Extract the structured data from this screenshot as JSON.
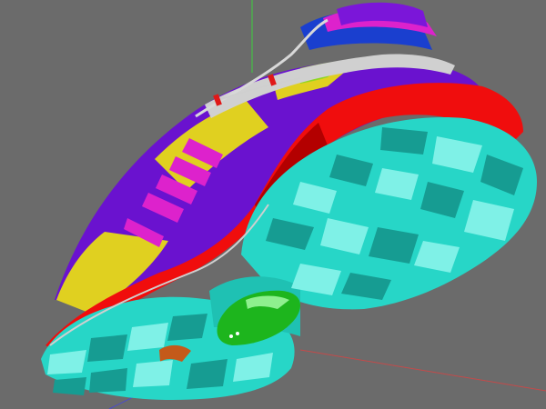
{
  "viewport": {
    "background": "#6b6b6b",
    "axis_colors": {
      "y": "#3ecf3e",
      "x": "#c44a4a",
      "z": "#4a4ad0"
    }
  },
  "model": {
    "palette": {
      "outsole": "#27d6c7",
      "outsole_shadow": "#169c92",
      "outsole_highlight": "#7ff1e7",
      "midsole": "#f00d0d",
      "midsole_shadow": "#b30000",
      "upper_purple": "#6a12cf",
      "upper_yellow": "#e0d020",
      "stripes_magenta": "#dd22cc",
      "collar_blue": "#1a3fcf",
      "lace_silver": "#c8c8c8",
      "cushion_green": "#1db51d",
      "welt_grey": "#cfcfcf"
    }
  }
}
